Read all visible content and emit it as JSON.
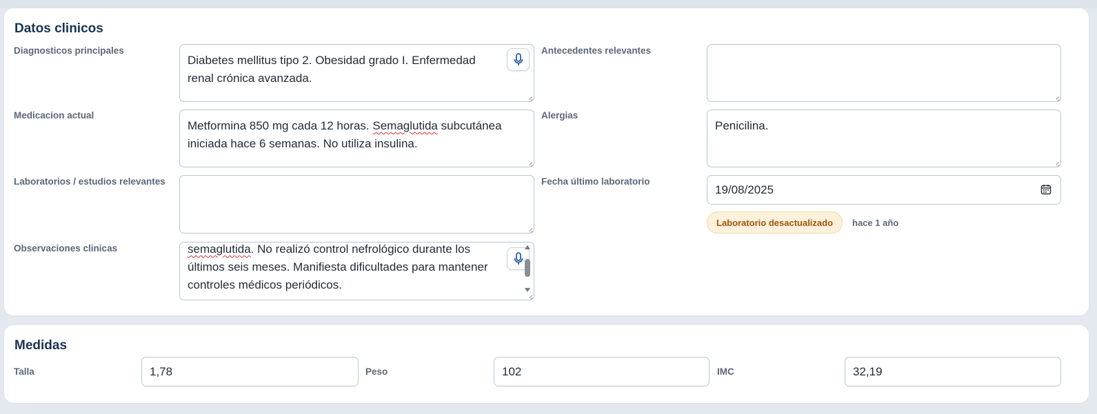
{
  "clinical": {
    "title": "Datos clinicos",
    "diagnosticos": {
      "label": "Diagnosticos principales",
      "value": "Diabetes mellitus tipo 2. Obesidad grado I. Enfermedad renal crónica avanzada."
    },
    "antecedentes": {
      "label": "Antecedentes relevantes",
      "value": ""
    },
    "medicacion": {
      "label": "Medicacion actual",
      "value_part1": "Metformina 850 mg cada 12 horas. ",
      "value_misspelled": "Semaglutida",
      "value_part2": " subcutánea iniciada hace 6 semanas. No utiliza insulina."
    },
    "alergias": {
      "label": "Alergias",
      "value": "Penicilina."
    },
    "laboratorios": {
      "label": "Laboratorios / estudios relevantes",
      "value": ""
    },
    "fecha_lab": {
      "label": "Fecha último laboratorio",
      "value": "19/08/2025",
      "badge": "Laboratorio desactualizado",
      "age": "hace 1 año"
    },
    "observaciones": {
      "label": "Observaciones clinicas",
      "value_misspelled": "semaglutida",
      "value_rest": ". No realizó control nefrológico durante los últimos seis meses. Manifiesta dificultades para mantener controles médicos periódicos."
    }
  },
  "measures": {
    "title": "Medidas",
    "talla": {
      "label": "Talla",
      "value": "1,78"
    },
    "peso": {
      "label": "Peso",
      "value": "102"
    },
    "imc": {
      "label": "IMC",
      "value": "32,19"
    }
  },
  "icons": {
    "mic": "microphone-icon",
    "calendar": "calendar-icon"
  },
  "colors": {
    "accent": "#2b5fa8",
    "badge_bg": "#fdf1dc",
    "badge_text": "#9a5508",
    "title": "#1b3352"
  }
}
